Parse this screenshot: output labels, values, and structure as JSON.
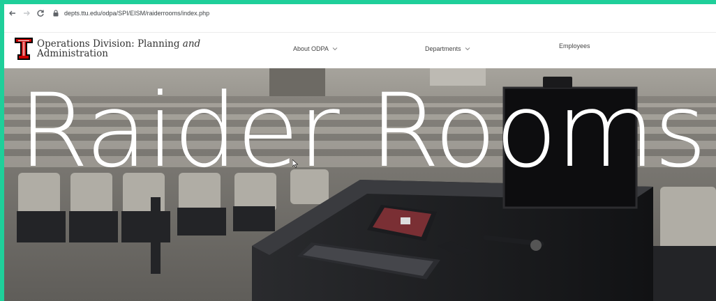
{
  "browser": {
    "url": "depts.ttu.edu/odpa/SPI/EISM/raiderrooms/index.php"
  },
  "header": {
    "title_line1_prefix": "Operations Division: Planning ",
    "title_line1_italic": "and",
    "title_line2": "Administration",
    "nav": [
      {
        "label": "About ODPA"
      },
      {
        "label": "Departments"
      },
      {
        "label": "Employees"
      }
    ]
  },
  "hero": {
    "title": "Raider Rooms"
  },
  "colors": {
    "accent_frame": "#1fcf9a",
    "brand_red": "#cc0000"
  },
  "icons": {
    "back": "arrow-left-icon",
    "forward": "arrow-right-icon",
    "reload": "reload-icon",
    "lock": "lock-icon",
    "logo": "texas-tech-double-t-logo",
    "chevron": "chevron-down-icon"
  }
}
